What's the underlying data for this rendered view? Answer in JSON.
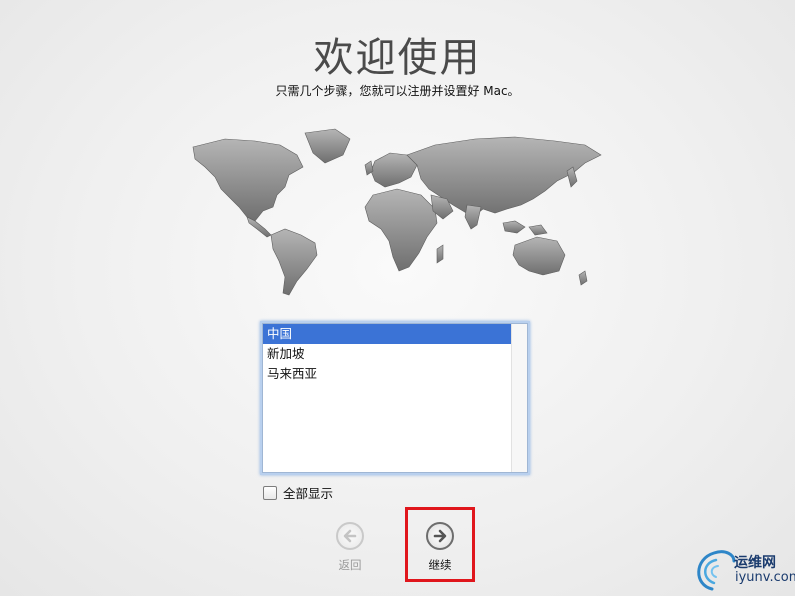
{
  "page": {
    "title": "欢迎使用",
    "subtitle": "只需几个步骤，您就可以注册并设置好 Mac。"
  },
  "country_list": {
    "items": [
      "中国",
      "新加坡",
      "马来西亚"
    ],
    "selected_index": 0
  },
  "show_all": {
    "label": "全部显示",
    "checked": false
  },
  "nav": {
    "back_label": "返回",
    "continue_label": "继续",
    "back_enabled": false
  },
  "watermark": {
    "name": "运维网",
    "domain": "iyunv.com"
  },
  "colors": {
    "selection": "#3b73d6",
    "highlight_box": "#e0161c",
    "map_land": "#8f8f8f"
  },
  "icons": {
    "back": "left-arrow-circle-icon",
    "continue": "right-arrow-circle-icon",
    "map": "world-map-icon"
  }
}
